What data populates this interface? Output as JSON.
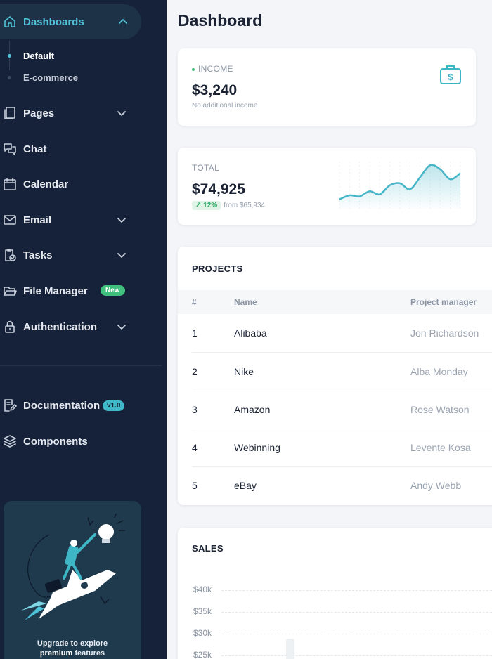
{
  "sidebar": {
    "dashboards": "Dashboards",
    "sub_items": [
      "Default",
      "E-commerce"
    ],
    "pages": "Pages",
    "chat": "Chat",
    "calendar": "Calendar",
    "email": "Email",
    "tasks": "Tasks",
    "file_manager": "File Manager",
    "file_manager_badge": "New",
    "authentication": "Authentication",
    "documentation": "Documentation",
    "documentation_badge": "v1.0",
    "components": "Components",
    "promo_line1": "Upgrade to explore",
    "promo_bold": "premium",
    "promo_rest": "features"
  },
  "header": {
    "title": "Dashboard"
  },
  "income": {
    "label": "INCOME",
    "value": "$3,240",
    "sub": "No additional income"
  },
  "total": {
    "label": "TOTAL",
    "value": "$74,925",
    "trend": "12%",
    "from": "from $65,934"
  },
  "projects": {
    "title": "PROJECTS",
    "columns": [
      "#",
      "Name",
      "Project manager"
    ],
    "rows": [
      {
        "num": "1",
        "name": "Alibaba",
        "manager": "Jon Richardson"
      },
      {
        "num": "2",
        "name": "Nike",
        "manager": "Alba Monday"
      },
      {
        "num": "3",
        "name": "Amazon",
        "manager": "Rose Watson"
      },
      {
        "num": "4",
        "name": "Webinning",
        "manager": "Levente Kosa"
      },
      {
        "num": "5",
        "name": "eBay",
        "manager": "Andy Webb"
      }
    ]
  },
  "sales": {
    "title": "SALES",
    "y_ticks": [
      "$40k",
      "$35k",
      "$30k",
      "$25k"
    ]
  },
  "chart_data": {
    "type": "line",
    "title": "",
    "x": [
      0,
      1,
      2,
      3,
      4,
      5,
      6,
      7,
      8,
      9,
      10,
      11,
      12
    ],
    "series": [
      {
        "values": [
          10,
          14,
          13,
          18,
          15,
          24,
          26,
          20,
          32,
          44,
          40,
          30,
          36
        ]
      }
    ],
    "color": "#46b6c8"
  },
  "colors": {
    "accent": "#4fc3d8",
    "sidebar_bg": "#16223a",
    "success": "#3fc07d"
  }
}
